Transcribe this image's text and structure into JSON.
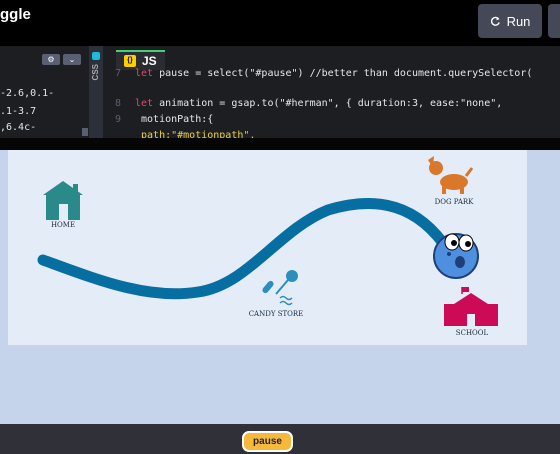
{
  "header": {
    "title": "ggle",
    "run_label": "Run"
  },
  "css_panel": {
    "tab_label": "CSS",
    "lines": [
      "-2.6,0.1-",
      ".1-3.7",
      ",6.4c-"
    ]
  },
  "js_panel": {
    "tab_label": "JS",
    "lines": [
      {
        "num": "7",
        "kw": "let",
        "rest": " pause = select(\"#pause\") //better than document.querySelector("
      },
      {
        "num": "",
        "kw": "",
        "rest": ""
      },
      {
        "num": "8",
        "kw": "let",
        "rest": " animation = gsap.to(\"#herman\", { duration:3, ease:\"none\","
      },
      {
        "num": "9",
        "kw": "",
        "rest": "  motionPath:{"
      },
      {
        "num": "",
        "kw": "",
        "rest": "    path:\"#motionpath\","
      }
    ]
  },
  "scene": {
    "labels": {
      "home": "HOME",
      "dog_park": "DOG PARK",
      "candy_store": "CANDY STORE",
      "school": "SCHOOL"
    },
    "colors": {
      "path": "#076ea1",
      "home": "#2a8a8a",
      "dog": "#d9782a",
      "candy": "#2a8fbf",
      "school": "#cc0a55",
      "herman": "#4f8fe0"
    }
  },
  "footer": {
    "pause_label": "pause"
  }
}
